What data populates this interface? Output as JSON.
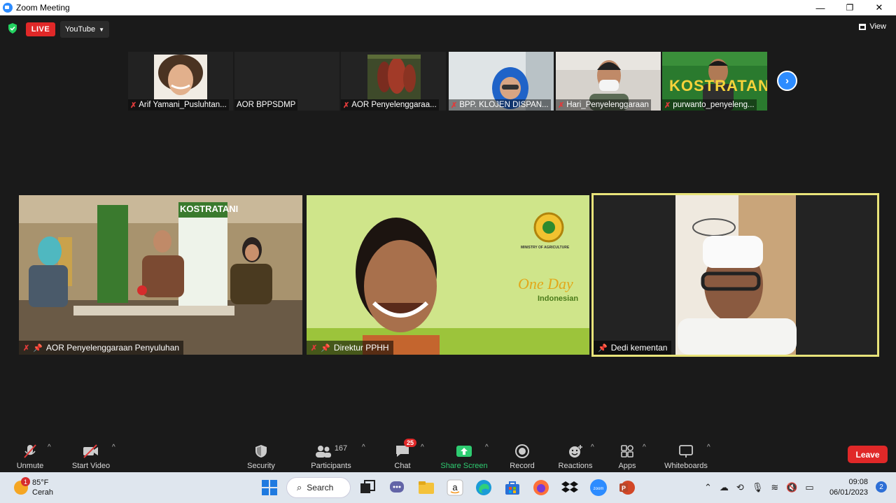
{
  "window": {
    "title": "Zoom Meeting",
    "minimize": "—",
    "maximize": "❐",
    "close": "✕"
  },
  "topbar": {
    "live_label": "LIVE",
    "stream_label": "YouTube",
    "view_label": "View"
  },
  "thumbnails": [
    {
      "name": "Arif Yamani_Pusluhtan...",
      "muted": true
    },
    {
      "name": "AOR BPPSDMP",
      "muted": false
    },
    {
      "name": "AOR Penyelenggaraa...",
      "muted": true
    },
    {
      "name": "BPP. KLOJEN DISPAN...",
      "muted": true
    },
    {
      "name": "Hari_Penyelenggaraan",
      "muted": true
    },
    {
      "name": "purwanto_penyeleng...",
      "muted": true
    }
  ],
  "tiles": [
    {
      "name": "AOR Penyelenggaraan Penyuluhan",
      "poster_text": "KOSTRATANI"
    },
    {
      "name": "Direktur PPHH",
      "slide_line1": "One Day",
      "slide_line2": "Indonesian",
      "slide_line3": "MINISTRY OF AGRICULTURE"
    },
    {
      "name": "Dedi kementan"
    }
  ],
  "thumb_poster": "KOSTRATANI",
  "toolbar": {
    "unmute": "Unmute",
    "start_video": "Start Video",
    "security": "Security",
    "participants": "Participants",
    "participants_count": "167",
    "chat": "Chat",
    "chat_badge": "25",
    "share_screen": "Share Screen",
    "record": "Record",
    "reactions": "Reactions",
    "apps": "Apps",
    "whiteboards": "Whiteboards",
    "leave": "Leave"
  },
  "taskbar": {
    "weather_temp": "85°F",
    "weather_desc": "Cerah",
    "weather_badge": "1",
    "search_label": "Search",
    "time": "09:08",
    "date": "06/01/2023",
    "notifications": "2"
  },
  "colors": {
    "accent": "#2d8cff",
    "live": "#e02828",
    "share_green": "#2ecc71",
    "active_speaker": "#e8e37a"
  }
}
